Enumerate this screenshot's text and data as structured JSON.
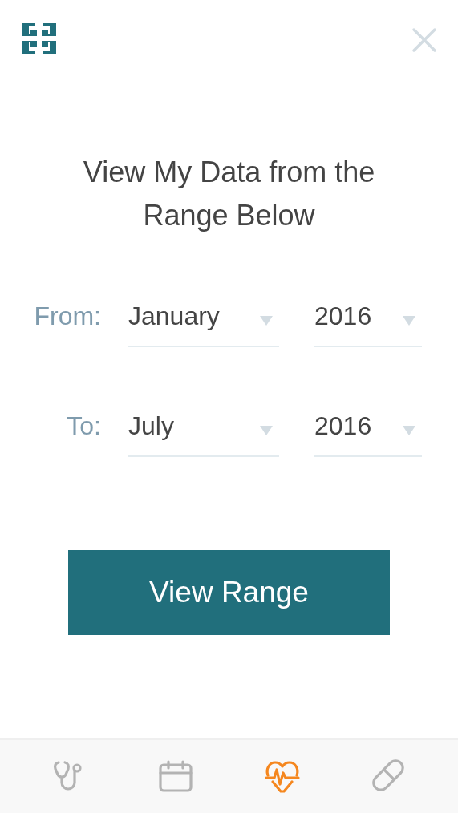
{
  "title": "View My Data from the Range Below",
  "ranges": [
    {
      "label": "From:",
      "month": "January",
      "year": "2016"
    },
    {
      "label": "To:",
      "month": "July",
      "year": "2016"
    }
  ],
  "button": "View Range",
  "tabs": [
    {
      "kind": "stethoscope",
      "selected": false
    },
    {
      "kind": "calendar",
      "selected": false
    },
    {
      "kind": "heart",
      "selected": true
    },
    {
      "kind": "pill",
      "selected": false
    }
  ]
}
